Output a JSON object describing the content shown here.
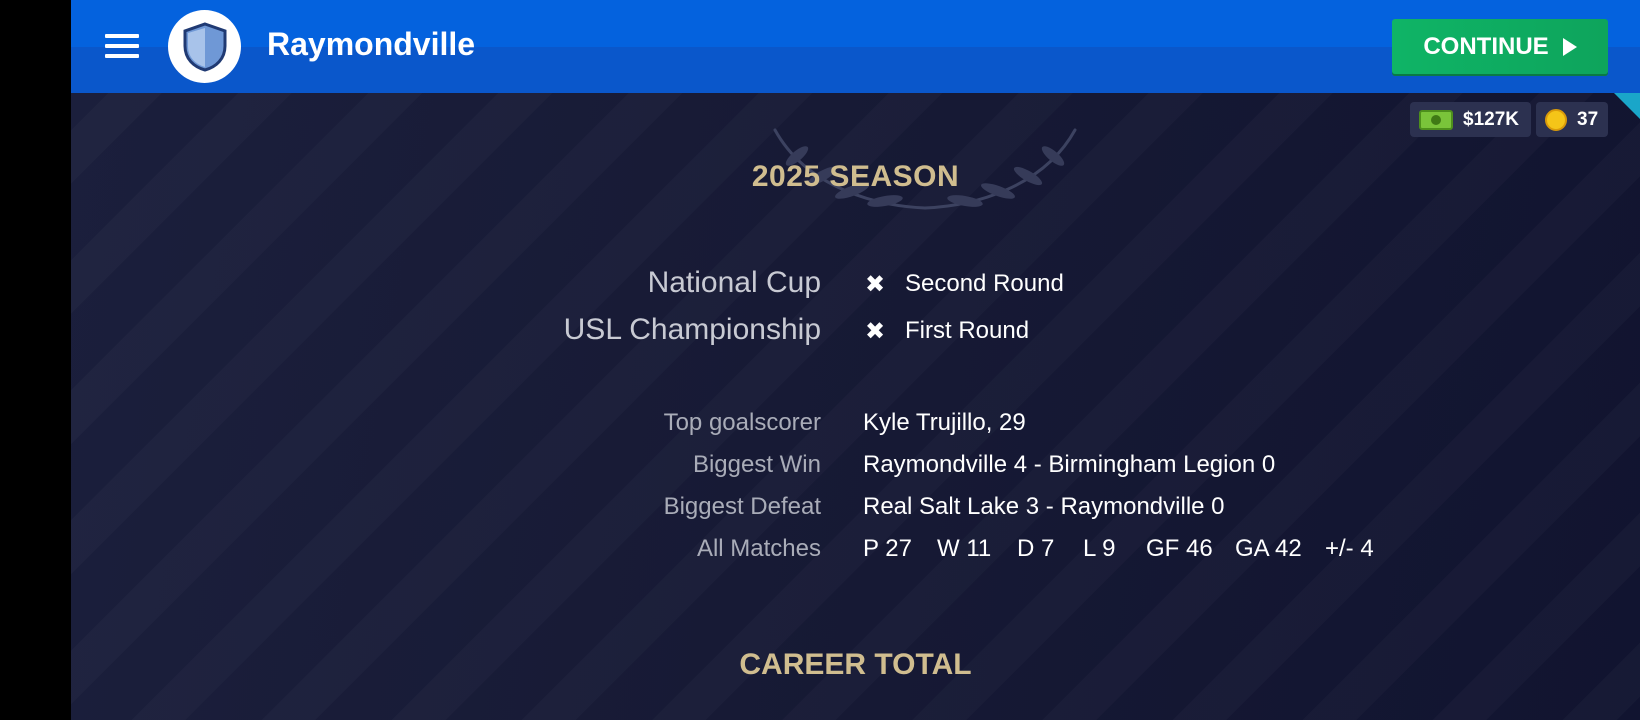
{
  "header": {
    "club_name": "Raymondville",
    "continue_label": "CONTINUE",
    "icons": {
      "menu": "hamburger-menu-icon",
      "crest": "shield-crest-icon",
      "continue": "play-arrow-icon"
    }
  },
  "currency": {
    "money": "$127K",
    "coins": "37",
    "icons": {
      "money": "cash-icon",
      "coins": "coin-icon"
    }
  },
  "season": {
    "title": "2025 SEASON",
    "competitions": [
      {
        "name": "National Cup",
        "icon": "x-icon",
        "result": "Second Round"
      },
      {
        "name": "USL Championship",
        "icon": "x-icon",
        "result": "First Round"
      }
    ],
    "stats": {
      "top_goalscorer_label": "Top goalscorer",
      "top_goalscorer_value": "Kyle Trujillo, 29",
      "biggest_win_label": "Biggest Win",
      "biggest_win_value": "Raymondville 4 - Birmingham Legion 0",
      "biggest_defeat_label": "Biggest Defeat",
      "biggest_defeat_value": "Real Salt Lake 3 - Raymondville 0",
      "all_matches_label": "All Matches",
      "all_matches": {
        "played": "P 27",
        "won": "W 11",
        "drawn": "D 7",
        "lost": "L 9",
        "goals_for": "GF 46",
        "goals_against": "GA 42",
        "goal_diff": "+/- 4"
      }
    }
  },
  "career": {
    "title": "CAREER TOTAL"
  },
  "colors": {
    "header_blue": "#0462de",
    "continue_green": "#0fb466",
    "gold_title": "#d0bd8f",
    "background": "#1b1f3c"
  }
}
